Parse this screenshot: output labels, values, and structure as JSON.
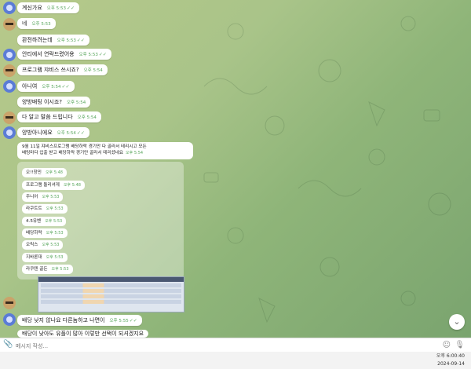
{
  "messages": [
    {
      "text": "계신가요",
      "time": "오후 5:53",
      "checks": "✓✓"
    },
    {
      "text": "네",
      "time": "오후 5:53",
      "checks": ""
    },
    {
      "text": "환전하려는데",
      "time": "오후 5:53",
      "checks": "✓✓"
    },
    {
      "text": "안티에서 연락드렸어용",
      "time": "오후 5:53",
      "checks": "✓✓"
    },
    {
      "text": "프로그램 쟈비스 쓰시죠?",
      "time": "오후 5:54",
      "checks": ""
    },
    {
      "text": "아니여",
      "time": "오후 5:54",
      "checks": "✓✓"
    },
    {
      "text": "양방배팅 이시죠?",
      "time": "오후 5:54",
      "checks": ""
    },
    {
      "text": "다 알고 말씀 드립니다",
      "time": "오후 5:54",
      "checks": ""
    },
    {
      "text": "양방아니에요",
      "time": "오후 5:54",
      "checks": "✓✓"
    }
  ],
  "long_message": {
    "line1": "9월 11일 쟈비스프로그램 배당하락 경기만 다 골라서 테리시고 모든",
    "line2": "배팅마다 입출 받고 배당하락 경기만 골라서 테리셨네요",
    "time": "오후 5:54"
  },
  "image_list": [
    {
      "text": "오!!창민",
      "time": "오후 5:48"
    },
    {
      "text": "프로그램 돌리셔게",
      "time": "오후 5:48"
    },
    {
      "text": "주니어",
      "time": "오후 5:53"
    },
    {
      "text": "라쿠트트",
      "time": "오후 5:53"
    },
    {
      "text": "4.5유벤",
      "time": "오후 5:53"
    },
    {
      "text": "배당하락",
      "time": "오후 5:53"
    },
    {
      "text": "오릭스",
      "time": "오후 5:53"
    },
    {
      "text": "지바론대",
      "time": "오후 5:53"
    },
    {
      "text": "라쿠텐 골든",
      "time": "오후 5:53"
    }
  ],
  "bottom_messages": [
    {
      "text": "배당 낮지 않나요 다른놈하고 나면이",
      "time": "오후 5:55",
      "checks": "✓✓"
    },
    {
      "text": "배당이 낮아도 유플이 많아 이렇만 선택이 되셔겠지요",
      "time": "",
      "checks": ""
    }
  ],
  "composer": {
    "placeholder": "메시지 작성..."
  },
  "clock": {
    "time": "오후 6:00:40",
    "date": "2024-09-14"
  },
  "icons": {
    "scroll": "chevron-down-icon",
    "attach": "paperclip-icon",
    "emoji": "emoji-icon",
    "voice": "microphone-icon"
  },
  "colors": {
    "accent": "#5aa75e",
    "bubble": "#ffffff"
  }
}
